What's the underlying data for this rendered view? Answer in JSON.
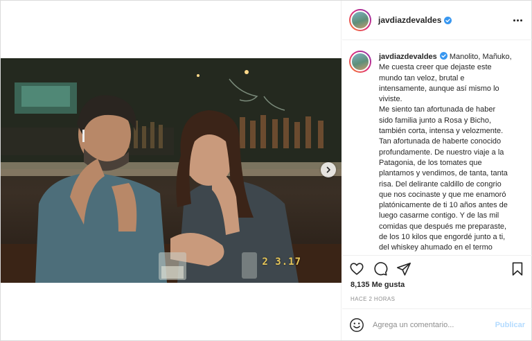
{
  "post": {
    "username": "javdiazdevaldes",
    "photo_stamp": "2 3.17",
    "caption_lines": [
      "Manolito, Mañuko,",
      "Me cuesta creer que dejaste este",
      "mundo tan veloz, brutal e",
      "intensamente, aunque así mismo lo",
      "viviste.",
      "Me siento tan afortunada de haber",
      "sido familia junto a Rosa y Bicho,",
      "también corta, intensa y velozmente.",
      "Tan afortunada de haberte conocido",
      "profundamente. De nuestro viaje a la",
      "Patagonia, de los tomates que",
      "plantamos y vendimos, de tanta, tanta",
      "risa. Del delirante caldillo de congrio",
      "que nos cocinaste y que me enamoró",
      "platónicamente de ti 10 años antes de",
      "luego casarme contigo. Y de las mil",
      "comidas que después me preparaste,",
      "de los 10 kilos que engordé junto a ti,",
      "del whiskey ahumado en el termo"
    ],
    "likes": "8,135 Me gusta",
    "time_ago": "HACE 2 HORAS",
    "comment_placeholder": "Agrega un comentario...",
    "publish_label": "Publicar"
  },
  "icons": {
    "more": "more-options-icon",
    "verified": "verified-badge-icon",
    "like": "heart-icon",
    "comment": "comment-icon",
    "share": "share-icon",
    "save": "bookmark-icon",
    "emoji": "emoji-icon",
    "next": "chevron-right-icon"
  },
  "colors": {
    "verified": "#3897f0",
    "publish_disabled": "#b3dbff",
    "border": "#dbdbdb",
    "muted_text": "#8e8e8e"
  }
}
